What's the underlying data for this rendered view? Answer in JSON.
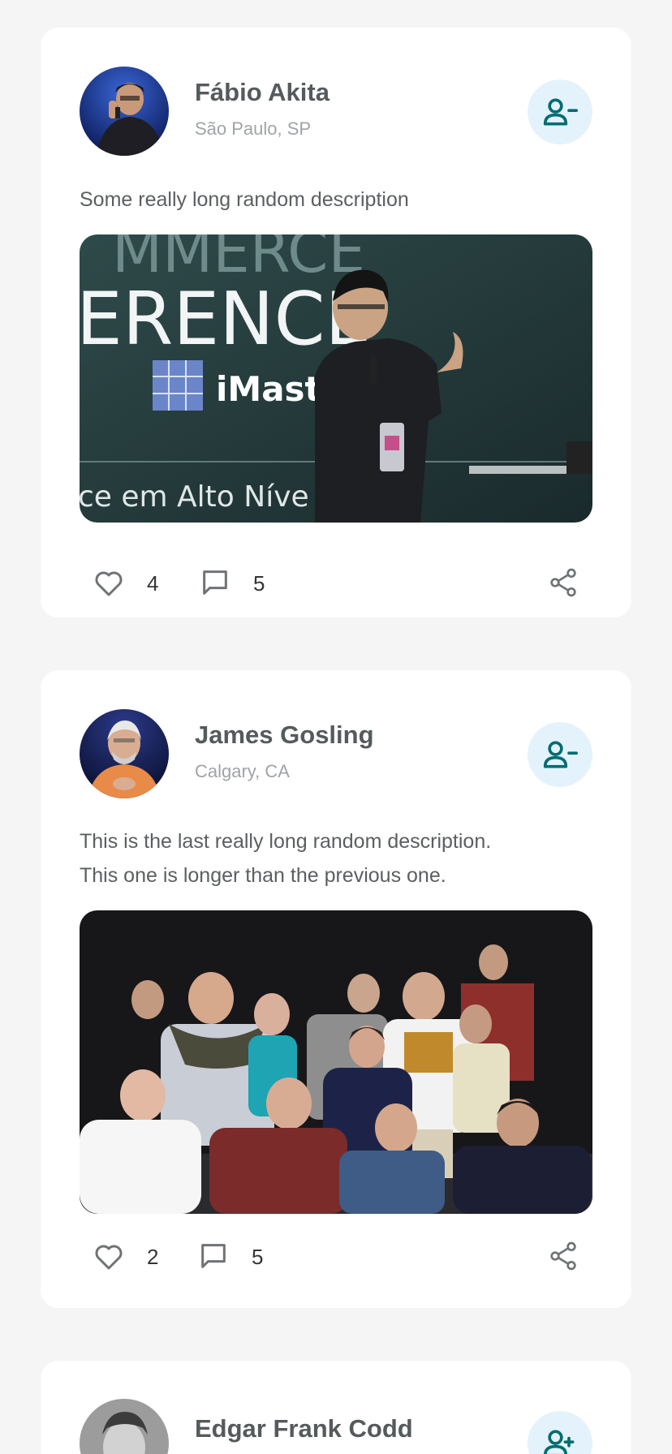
{
  "posts": [
    {
      "author": "Fábio Akita",
      "location": "São Paulo, SP",
      "description": "Some really long random description",
      "likes": "4",
      "comments": "5",
      "follow_state": "following",
      "image_text": {
        "line1": "MMERCE",
        "line2": "ERENCE",
        "brand": "iMast",
        "line3": "ce em Alto Níve"
      }
    },
    {
      "author": "James Gosling",
      "location": "Calgary, CA",
      "description_line1": "This is the last really long random description.",
      "description_line2": "This one is longer than the previous one.",
      "likes": "2",
      "comments": "5",
      "follow_state": "following"
    },
    {
      "author": "Edgar Frank Codd",
      "follow_state": "not-following"
    }
  ],
  "colors": {
    "page_background": "#f5f5f5",
    "card": "#ffffff",
    "accent_teal": "#006c73",
    "follow_button_bg": "#e4f3fb",
    "name_text": "#555a5c",
    "location_text": "#a0a4a6",
    "icon_gray": "#6f7375"
  },
  "icons": {
    "unfollow": "user-minus-icon",
    "follow": "user-plus-icon",
    "like": "heart-icon",
    "comment": "comment-icon",
    "share": "share-icon"
  }
}
